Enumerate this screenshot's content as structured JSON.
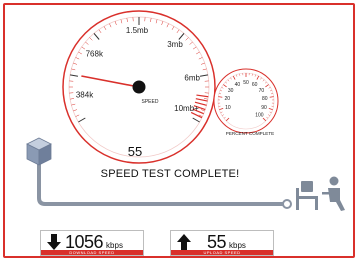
{
  "speedometer": {
    "labels": [
      "384k",
      "768k",
      "1.5mb",
      "3mb",
      "6mb",
      "10mb+"
    ],
    "caption": "SPEED",
    "needle_fraction": 0.17
  },
  "percent_gauge": {
    "labels": [
      "10",
      "20",
      "30",
      "40",
      "50",
      "60",
      "70",
      "80",
      "90",
      "100"
    ],
    "caption": "PERCENT COMPLETE",
    "value_percent": 100
  },
  "reading": "55",
  "status_text": "SPEED TEST COMPLETE!",
  "download": {
    "value": "1056",
    "unit": "kbps",
    "label": "DOWNLOAD SPEED"
  },
  "upload": {
    "value": "55",
    "unit": "kbps",
    "label": "UPLOAD SPEED"
  },
  "colors": {
    "accent": "#d9302b",
    "line": "#8a94a3",
    "server": "#7f8ea8"
  },
  "icons": {
    "server": "server-cube-icon",
    "user": "user-at-desk-icon",
    "download_arrow": "arrow-down-icon",
    "upload_arrow": "arrow-up-icon"
  }
}
